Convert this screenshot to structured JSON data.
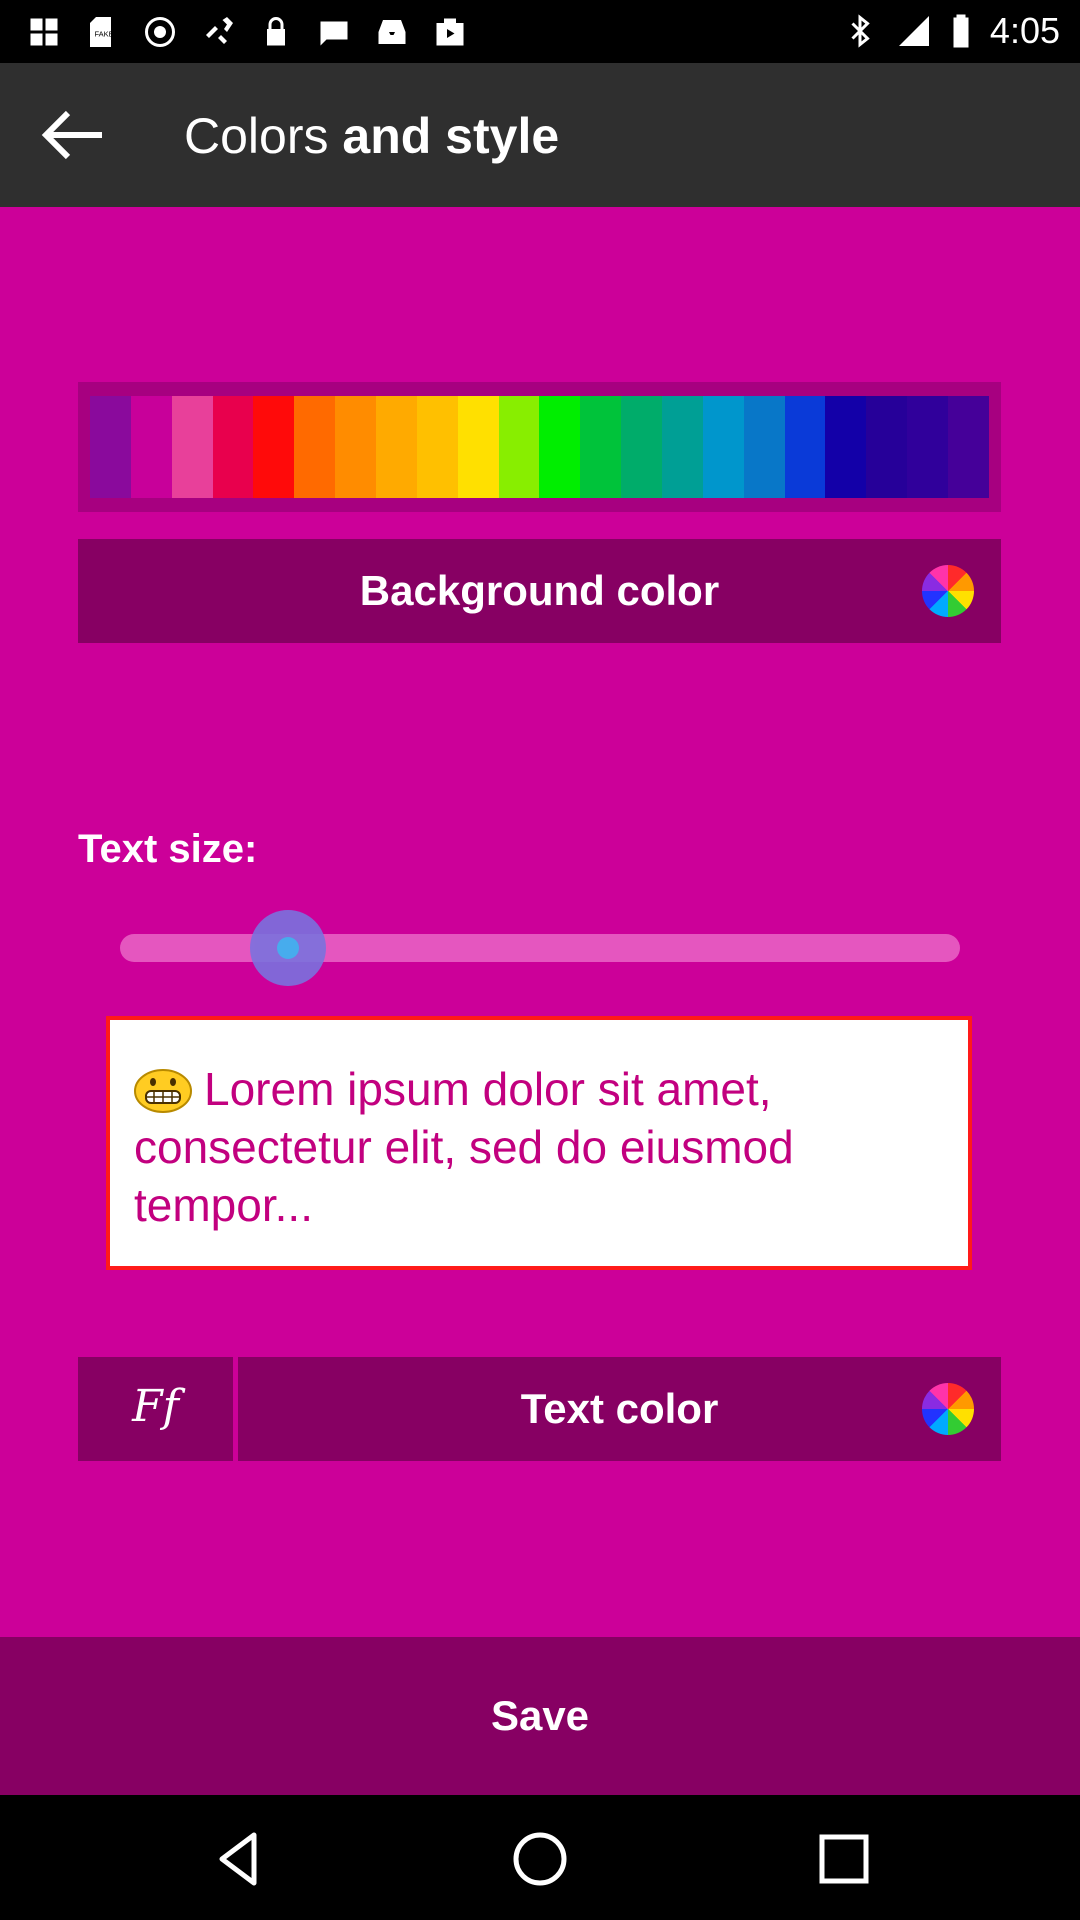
{
  "status_bar": {
    "time": "4:05",
    "left_icons": [
      "photos-icon",
      "sdcard-icon",
      "target-icon",
      "satellite-icon",
      "lock-icon",
      "sms-icon",
      "inbox-icon",
      "play-store-icon"
    ],
    "right_icons": [
      "bluetooth-icon",
      "signal-icon",
      "battery-icon"
    ]
  },
  "app_bar": {
    "title_light": "Colors",
    "title_bold": "and style",
    "back_icon": "arrow-left-icon"
  },
  "palette": {
    "colors": [
      "#8a0a9c",
      "#c8009a",
      "#e8409a",
      "#e8004d",
      "#ff0a0a",
      "#ff6a00",
      "#ff8c00",
      "#ffaa00",
      "#ffc000",
      "#ffe000",
      "#88ee00",
      "#00ee00",
      "#00c33a",
      "#00ac6a",
      "#009f95",
      "#0096cc",
      "#0877c8",
      "#0a3ad8",
      "#1300a8",
      "#260099",
      "#30009b",
      "#450099"
    ]
  },
  "background_color_button": {
    "label": "Background color",
    "icon": "color-wheel-icon"
  },
  "text_size": {
    "label": "Text size:",
    "slider_value": 0.2
  },
  "preview": {
    "text": "Lorem ipsum dolor sit amet, consectetur elit, sed do eiusmod tempor...",
    "icon": "grinning-emoji-icon",
    "text_color": "#c2007f"
  },
  "font_button": {
    "label": "Ff",
    "icon": "font-icon"
  },
  "text_color_button": {
    "label": "Text color",
    "icon": "color-wheel-icon"
  },
  "save_button": {
    "label": "Save"
  },
  "nav_bar": {
    "icons": [
      "back-triangle-icon",
      "home-circle-icon",
      "recents-square-icon"
    ]
  },
  "colors": {
    "content_bg": "#cc0099",
    "button_bg": "#870063",
    "app_bar_bg": "#2f2f2f"
  }
}
